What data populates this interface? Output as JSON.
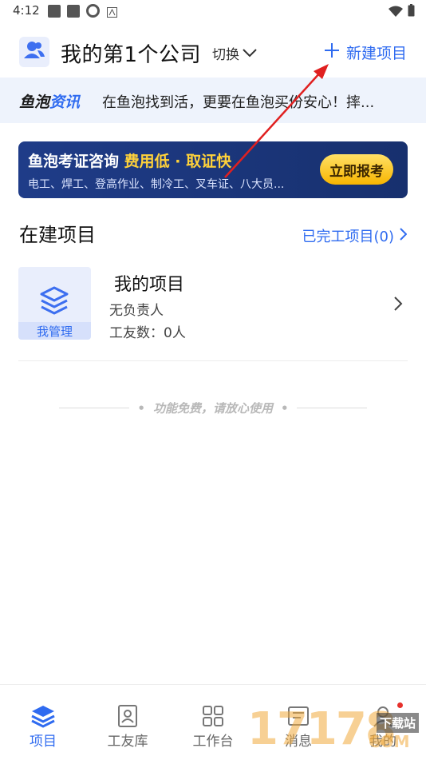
{
  "status_bar": {
    "time": "4:12"
  },
  "header": {
    "company_name": "我的第1个公司",
    "switch_label": "切换",
    "new_project_label": "新建项目"
  },
  "news": {
    "brand_part1": "鱼泡",
    "brand_part2": "资讯",
    "text": "在鱼泡找到活，更要在鱼泡买份安心！摔..."
  },
  "banner": {
    "title_part1": "鱼泡考证咨询",
    "title_highlight": "费用低 · 取证快",
    "subtitle": "电工、焊工、登高作业、制冷工、叉车证、八大员...",
    "button_label": "立即报考"
  },
  "section": {
    "title": "在建项目",
    "completed_link": "已完工项目(0)"
  },
  "project": {
    "name": "我的项目",
    "leader": "无负责人",
    "workers": "工友数：0人",
    "badge": "我管理"
  },
  "free_note": "功能免费，请放心使用",
  "tabs": [
    {
      "label": "项目",
      "icon": "layers-icon",
      "active": true
    },
    {
      "label": "工友库",
      "icon": "contact-book-icon",
      "active": false
    },
    {
      "label": "工作台",
      "icon": "grid-icon",
      "active": false
    },
    {
      "label": "消息",
      "icon": "message-icon",
      "active": false
    },
    {
      "label": "我的",
      "icon": "person-icon",
      "active": false
    }
  ],
  "watermark": {
    "main": "17178",
    "sub": "下载站",
    "com": "COM"
  },
  "colors": {
    "accent": "#2f6bf0",
    "banner_bg": "#1f3c88",
    "button_yellow": "#f7b500",
    "badge_dot": "#e6312c"
  }
}
